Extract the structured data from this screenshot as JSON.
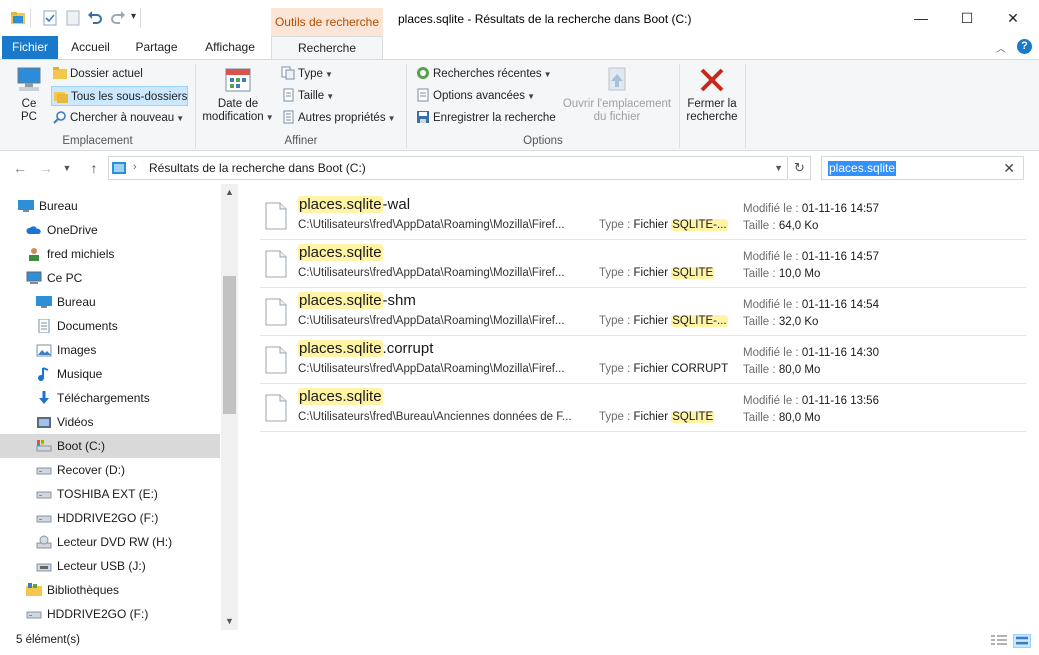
{
  "window": {
    "title": "places.sqlite - Résultats de la recherche dans Boot (C:)",
    "context_tab": "Outils de recherche",
    "minimize": "—",
    "maximize": "☐",
    "close": "✕"
  },
  "tabs": [
    "Fichier",
    "Accueil",
    "Partage",
    "Affichage",
    "Recherche"
  ],
  "ribbon": {
    "emplacement": {
      "label": "Emplacement",
      "ce_pc_line1": "Ce",
      "ce_pc_line2": "PC",
      "dossier_actuel": "Dossier actuel",
      "tous_sous_dossiers": "Tous les sous-dossiers",
      "chercher_nouveau": "Chercher à nouveau"
    },
    "affiner": {
      "label": "Affiner",
      "date_line1": "Date de",
      "date_line2": "modification",
      "type": "Type",
      "taille": "Taille",
      "autres_proprietes": "Autres propriétés"
    },
    "options": {
      "label": "Options",
      "recherches_recentes": "Recherches récentes",
      "options_avancees": "Options avancées",
      "enregistrer": "Enregistrer la recherche",
      "ouvrir_line1": "Ouvrir l'emplacement",
      "ouvrir_line2": "du fichier"
    },
    "fermer": {
      "line1": "Fermer la",
      "line2": "recherche"
    }
  },
  "address": {
    "path": "Résultats de la recherche dans Boot (C:)",
    "search_value": "places.sqlite"
  },
  "nav": [
    {
      "label": "Bureau",
      "icon": "desktop-icon",
      "level": 0
    },
    {
      "label": "OneDrive",
      "icon": "cloud-icon",
      "level": 1
    },
    {
      "label": "fred michiels",
      "icon": "user-icon",
      "level": 1
    },
    {
      "label": "Ce PC",
      "icon": "computer-icon",
      "level": 1
    },
    {
      "label": "Bureau",
      "icon": "desktop-icon",
      "level": 2
    },
    {
      "label": "Documents",
      "icon": "documents-icon",
      "level": 2
    },
    {
      "label": "Images",
      "icon": "images-icon",
      "level": 2
    },
    {
      "label": "Musique",
      "icon": "music-icon",
      "level": 2
    },
    {
      "label": "Téléchargements",
      "icon": "download-icon",
      "level": 2
    },
    {
      "label": "Vidéos",
      "icon": "video-icon",
      "level": 2
    },
    {
      "label": "Boot (C:)",
      "icon": "drive-c-icon",
      "level": 2,
      "selected": true
    },
    {
      "label": "Recover (D:)",
      "icon": "drive-icon",
      "level": 2
    },
    {
      "label": "TOSHIBA EXT (E:)",
      "icon": "drive-icon",
      "level": 2
    },
    {
      "label": "HDDRIVE2GO (F:)",
      "icon": "drive-icon",
      "level": 2
    },
    {
      "label": "Lecteur DVD RW (H:)",
      "icon": "dvd-icon",
      "level": 2
    },
    {
      "label": "Lecteur USB (J:)",
      "icon": "usb-icon",
      "level": 2
    },
    {
      "label": "Bibliothèques",
      "icon": "library-icon",
      "level": 1
    },
    {
      "label": "HDDRIVE2GO (F:)",
      "icon": "drive-icon",
      "level": 1
    }
  ],
  "results": [
    {
      "name_hl": "places.sqlite",
      "name_rest": "-wal",
      "path": "C:\\Utilisateurs\\fred\\AppData\\Roaming\\Mozilla\\Firef...",
      "type_label": "Type :",
      "type_prefix": "Fichier ",
      "type_hl": "SQLITE-...",
      "type_rest": "",
      "mod_label": "Modifié le :",
      "mod_value": "01-11-16 14:57",
      "size_label": "Taille :",
      "size_value": "64,0 Ko"
    },
    {
      "name_hl": "places.sqlite",
      "name_rest": "",
      "path": "C:\\Utilisateurs\\fred\\AppData\\Roaming\\Mozilla\\Firef...",
      "type_label": "Type :",
      "type_prefix": "Fichier ",
      "type_hl": "SQLITE",
      "type_rest": "",
      "mod_label": "Modifié le :",
      "mod_value": "01-11-16 14:57",
      "size_label": "Taille :",
      "size_value": "10,0 Mo"
    },
    {
      "name_hl": "places.sqlite",
      "name_rest": "-shm",
      "path": "C:\\Utilisateurs\\fred\\AppData\\Roaming\\Mozilla\\Firef...",
      "type_label": "Type :",
      "type_prefix": "Fichier ",
      "type_hl": "SQLITE-...",
      "type_rest": "",
      "mod_label": "Modifié le :",
      "mod_value": "01-11-16 14:54",
      "size_label": "Taille :",
      "size_value": "32,0 Ko"
    },
    {
      "name_hl": "places.sqlite",
      "name_rest": ".corrupt",
      "path": "C:\\Utilisateurs\\fred\\AppData\\Roaming\\Mozilla\\Firef...",
      "type_label": "Type :",
      "type_prefix": "Fichier CORRUPT",
      "type_hl": "",
      "type_rest": "",
      "mod_label": "Modifié le :",
      "mod_value": "01-11-16 14:30",
      "size_label": "Taille :",
      "size_value": "80,0 Mo"
    },
    {
      "name_hl": "places.sqlite",
      "name_rest": "",
      "path": "C:\\Utilisateurs\\fred\\Bureau\\Anciennes données de F...",
      "type_label": "Type :",
      "type_prefix": "Fichier ",
      "type_hl": "SQLITE",
      "type_rest": "",
      "mod_label": "Modifié le :",
      "mod_value": "01-11-16 13:56",
      "size_label": "Taille :",
      "size_value": "80,0 Mo"
    }
  ],
  "status": {
    "count": "5 élément(s)"
  },
  "colors": {
    "accent": "#1979ca",
    "highlight": "#fff3a6",
    "selection": "#3390ff",
    "context_tab_bg": "#fbe5d6",
    "context_tab_text": "#b34d00",
    "close_x": "#c42b1c"
  }
}
